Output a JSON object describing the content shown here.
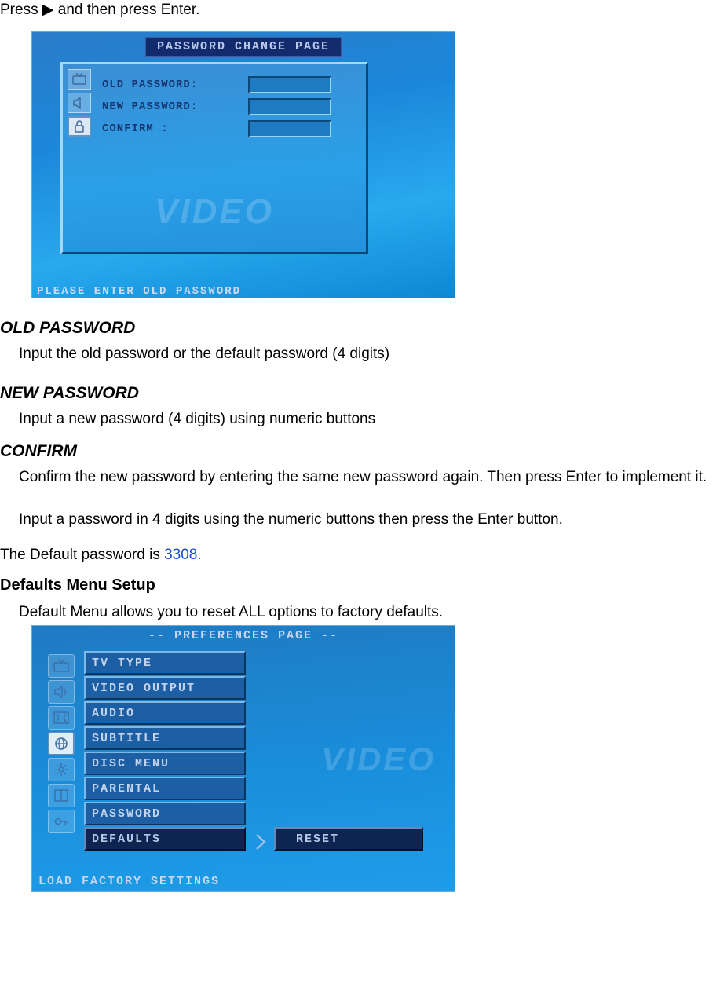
{
  "intro": {
    "press_text_pre": "Press ",
    "press_arrow": "▶",
    "press_text_post": " and then press Enter."
  },
  "password_screen": {
    "title": "PASSWORD CHANGE PAGE",
    "rows": [
      {
        "label": "OLD PASSWORD:"
      },
      {
        "label": "NEW PASSWORD:"
      },
      {
        "label": "CONFIRM :"
      }
    ],
    "watermark": "VIDEO",
    "status": "PLEASE ENTER OLD PASSWORD"
  },
  "sections": {
    "old_pw_heading": "OLD PASSWORD",
    "old_pw_body": "Input the old password or the default password (4 digits)",
    "new_pw_heading": "NEW PASSWORD",
    "new_pw_body": "Input a new password (4 digits) using numeric buttons",
    "confirm_heading": "CONFIRM",
    "confirm_body": "Confirm the new password by entering the same new password again. Then press Enter to implement it.",
    "note1": "Input a password in 4 digits using the numeric buttons then press the Enter button.",
    "default_pw_label": "The Default password is ",
    "default_pw_value": "3308.",
    "defaults_heading": "Defaults Menu Setup",
    "defaults_body": "Default Menu allows you to reset ALL options to factory defaults."
  },
  "pref_screen": {
    "title": "-- PREFERENCES PAGE --",
    "menu": [
      "TV TYPE",
      "VIDEO OUTPUT",
      "AUDIO",
      "SUBTITLE",
      "DISC MENU",
      "PARENTAL",
      "PASSWORD",
      "DEFAULTS"
    ],
    "selected_index": 7,
    "submenu_value": "RESET",
    "watermark": "VIDEO",
    "status": "LOAD FACTORY SETTINGS"
  }
}
